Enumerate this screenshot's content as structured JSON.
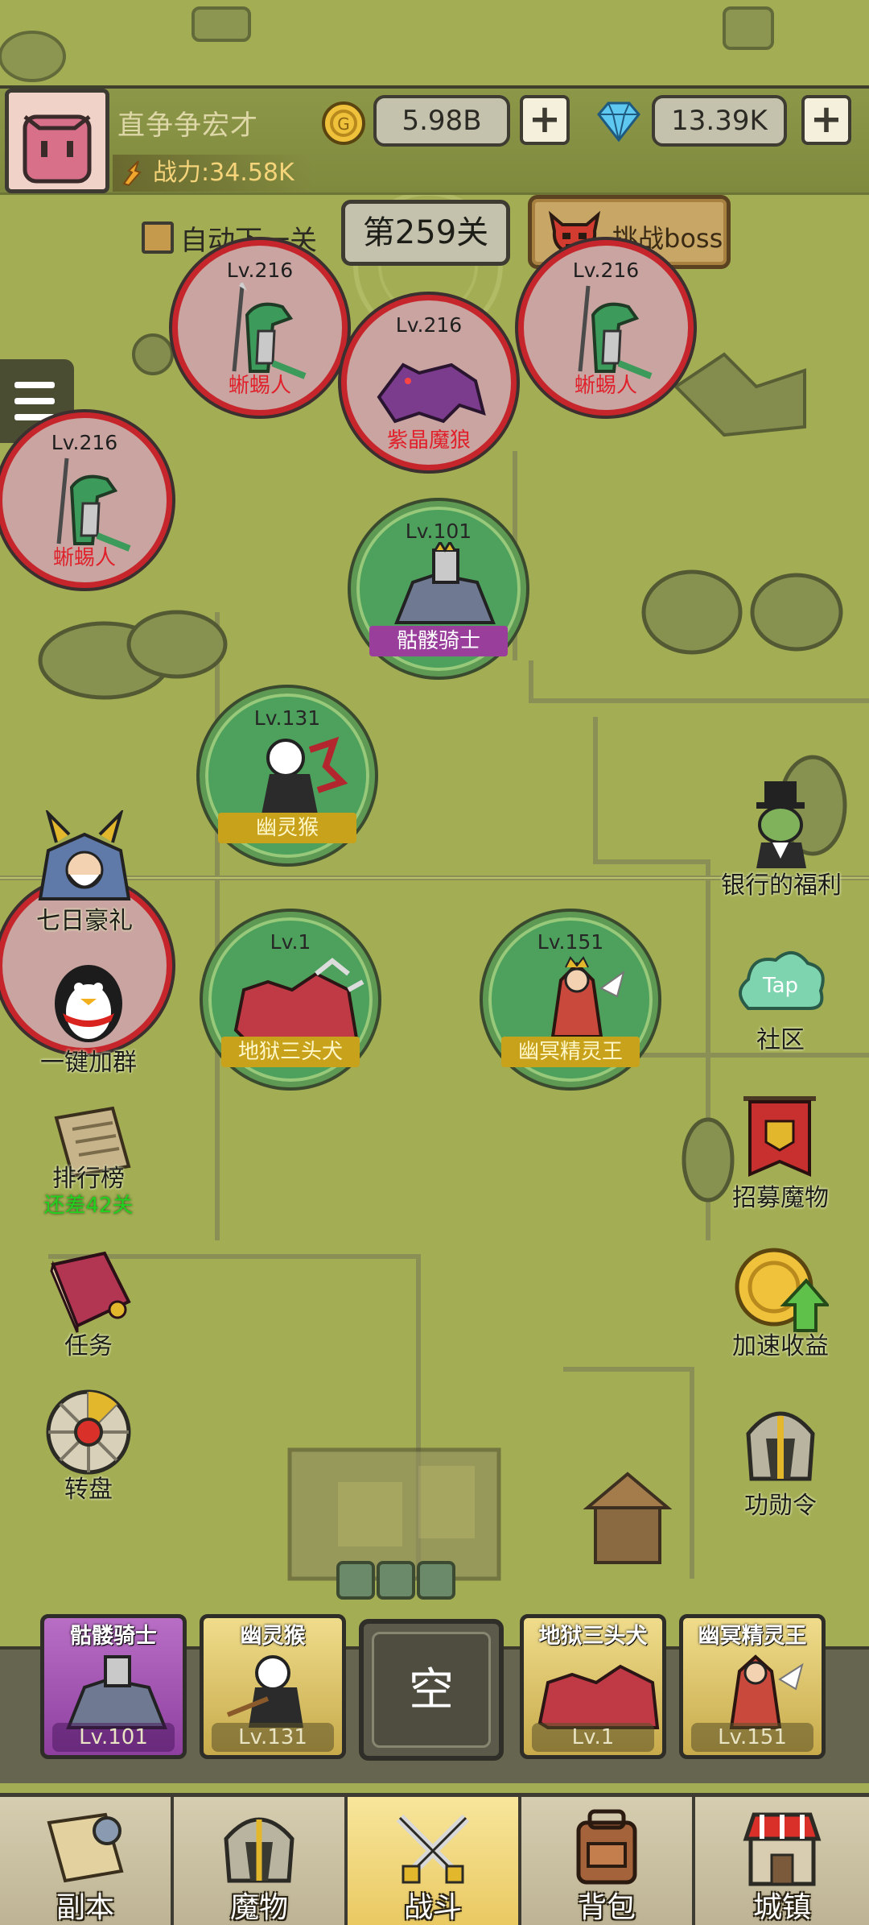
{
  "player": {
    "name": "直争争宏才",
    "power": "战力:34.58K",
    "gold": "5.98B",
    "gems": "13.39K"
  },
  "level": {
    "auto_next_label": "自动下一关",
    "current": "第259关",
    "boss_button": "挑战boss"
  },
  "enemies": [
    {
      "level": "Lv.216",
      "name": "蜥蜴人"
    },
    {
      "level": "Lv.216",
      "name": "紫晶魔狼"
    },
    {
      "level": "Lv.216",
      "name": "蜥蜴人"
    },
    {
      "level": "Lv.216",
      "name": "蜥蜴人"
    }
  ],
  "allies": [
    {
      "level": "Lv.101",
      "name": "骷髅骑士"
    },
    {
      "level": "Lv.131",
      "name": "幽灵猴"
    },
    {
      "level": "Lv.1",
      "name": "地狱三头犬"
    },
    {
      "level": "Lv.151",
      "name": "幽冥精灵王"
    }
  ],
  "left_actions": {
    "seven_day": "七日豪礼",
    "join_group": "一键加群",
    "ranking": "排行榜",
    "ranking_sub": "还差42关",
    "tasks": "任务",
    "wheel": "转盘"
  },
  "right_actions": {
    "bank": "银行的福利",
    "community": "社区",
    "tap_text": "Tap",
    "recruit": "招募魔物",
    "speedup": "加速收益",
    "merit": "功勋令"
  },
  "slots": [
    {
      "name": "骷髅骑士",
      "level": "Lv.101"
    },
    {
      "name": "幽灵猴",
      "level": "Lv.131"
    },
    {
      "name": "空"
    },
    {
      "name": "地狱三头犬",
      "level": "Lv.1"
    },
    {
      "name": "幽冥精灵王",
      "level": "Lv.151"
    }
  ],
  "nav": [
    {
      "label": "副本"
    },
    {
      "label": "魔物"
    },
    {
      "label": "战斗"
    },
    {
      "label": "背包"
    },
    {
      "label": "城镇"
    }
  ],
  "colors": {
    "map": "#a3ad53",
    "enemy_ring": "#c6262b",
    "ally_ring": "#5e9a53",
    "active_tab": "#f2d97a"
  }
}
